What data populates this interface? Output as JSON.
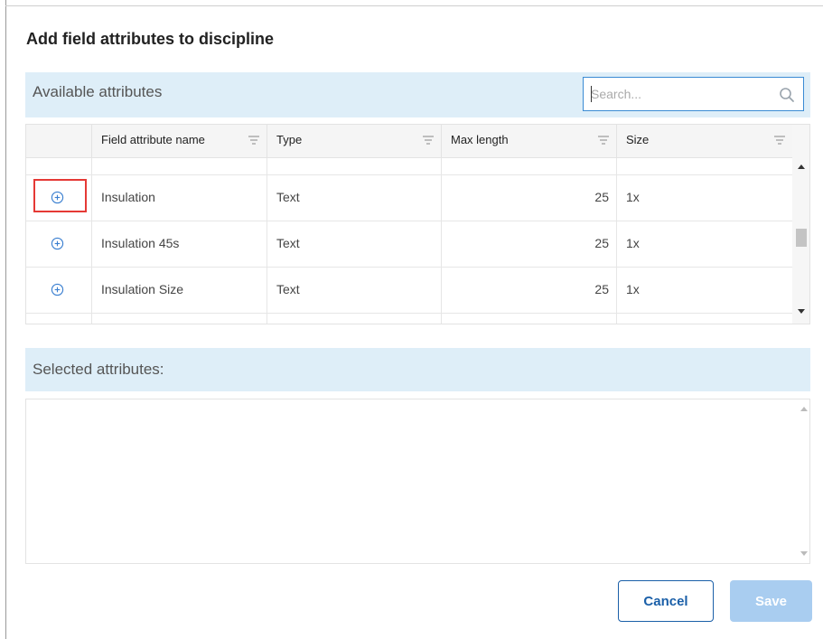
{
  "dialog": {
    "title": "Add field attributes to discipline"
  },
  "available": {
    "label": "Available attributes",
    "search_placeholder": "Search...",
    "columns": [
      "Field attribute name",
      "Type",
      "Max length",
      "Size"
    ],
    "rows": [
      {
        "name": "Insulation",
        "type": "Text",
        "max_length": "25",
        "size": "1x"
      },
      {
        "name": "Insulation 45s",
        "type": "Text",
        "max_length": "25",
        "size": "1x"
      },
      {
        "name": "Insulation Size",
        "type": "Text",
        "max_length": "25",
        "size": "1x"
      }
    ]
  },
  "selected": {
    "label": "Selected attributes:"
  },
  "buttons": {
    "cancel": "Cancel",
    "save": "Save"
  },
  "colors": {
    "header_band": "#deeef8",
    "accent": "#1a5fa8",
    "save_disabled": "#a9cdf0",
    "highlight": "#e53935"
  }
}
